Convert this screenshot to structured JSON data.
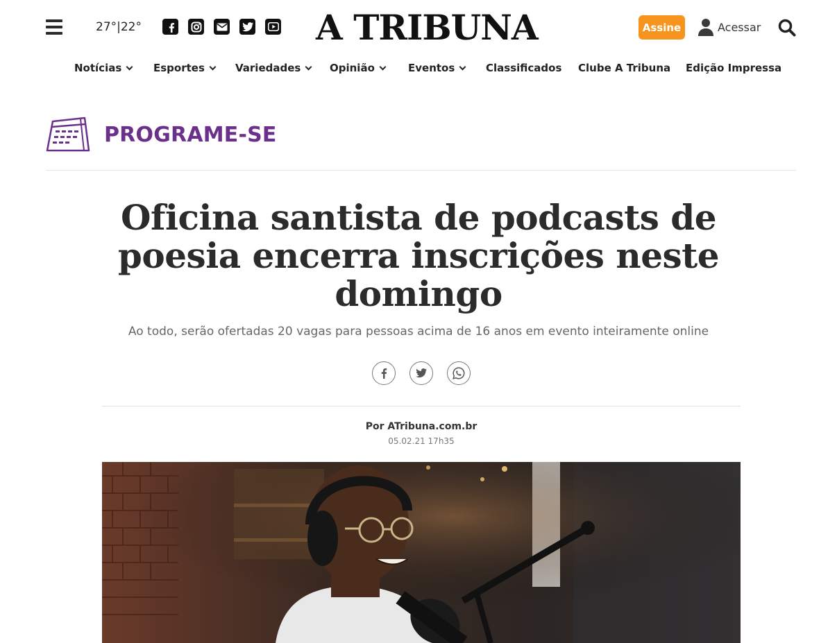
{
  "header": {
    "weather": "27°|22°",
    "logo": "A TRIBUNA",
    "subscribe_label": "Assine",
    "login_label": "Acessar"
  },
  "social_icons": [
    "facebook-icon",
    "instagram-icon",
    "email-icon",
    "twitter-icon",
    "youtube-icon"
  ],
  "nav": {
    "items": [
      {
        "label": "Notícias",
        "dropdown": true
      },
      {
        "label": "Esportes",
        "dropdown": true
      },
      {
        "label": "Variedades",
        "dropdown": true
      },
      {
        "label": "Opinião",
        "dropdown": true
      },
      {
        "label": "Eventos",
        "dropdown": true
      },
      {
        "label": "Classificados",
        "dropdown": false
      },
      {
        "label": "Clube A Tribuna",
        "dropdown": false
      },
      {
        "label": "Edição Impressa",
        "dropdown": false
      }
    ]
  },
  "section": {
    "title": "PROGRAME-SE",
    "color": "#6b2f8c"
  },
  "article": {
    "headline": "Oficina santista de podcasts de poesia encerra inscrições neste domingo",
    "subtitle": "Ao todo, serão ofertadas 20 vagas para pessoas acima de 16 anos em evento inteiramente online",
    "byline": "Por ATribuna.com.br",
    "date": "05.02.21 17h35"
  },
  "share_icons": [
    "facebook-icon",
    "twitter-icon",
    "whatsapp-icon"
  ],
  "colors": {
    "accent": "#f7941d",
    "section": "#6b2f8c",
    "text": "#2b2b2b"
  }
}
